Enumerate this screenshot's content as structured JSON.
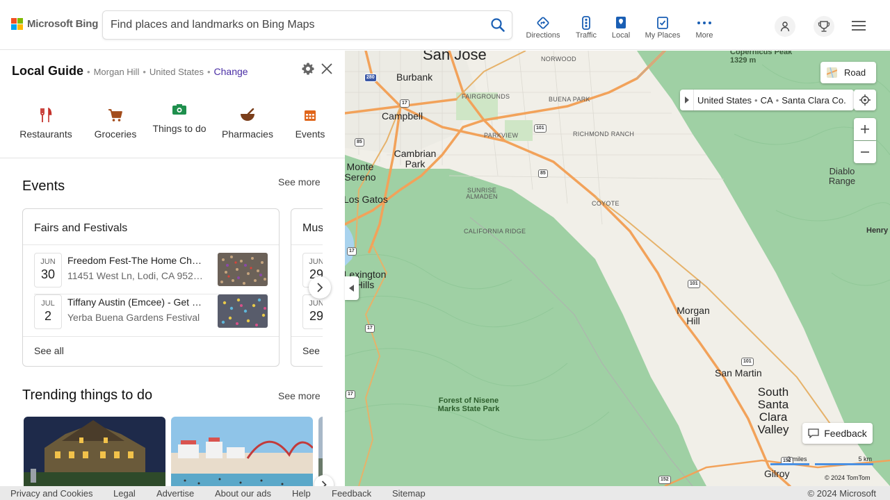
{
  "header": {
    "brand": "Microsoft Bing",
    "search_placeholder": "Find places and landmarks on Bing Maps",
    "nav": [
      {
        "label": "Directions",
        "icon": "directions-icon"
      },
      {
        "label": "Traffic",
        "icon": "traffic-icon"
      },
      {
        "label": "Local",
        "icon": "local-icon"
      },
      {
        "label": "My Places",
        "icon": "my-places-icon"
      },
      {
        "label": "More",
        "icon": "more-icon"
      }
    ],
    "accent": "#1a5fb4"
  },
  "panel": {
    "title": "Local Guide",
    "city": "Morgan Hill",
    "country": "United States",
    "change_label": "Change",
    "categories": [
      {
        "label": "Restaurants",
        "color": "#c5322b"
      },
      {
        "label": "Groceries",
        "color": "#a34c1b"
      },
      {
        "label": "Things to do",
        "color": "#1e8f4d"
      },
      {
        "label": "Pharmacies",
        "color": "#7a3e1b"
      },
      {
        "label": "Events",
        "color": "#e0661b"
      }
    ],
    "events": {
      "title": "Events",
      "see_more": "See more",
      "cards": [
        {
          "title": "Fairs and Festivals",
          "items": [
            {
              "month": "JUN",
              "day": "30",
              "title": "Freedom Fest-The Home Ch…",
              "address": "11451 West Ln, Lodi, CA 952…"
            },
            {
              "month": "JUL",
              "day": "2",
              "title": "Tiffany Austin (Emcee) - Get F…",
              "address": "Yerba Buena Gardens Festival"
            }
          ],
          "see_all": "See all"
        },
        {
          "title": "Mus",
          "items": [
            {
              "month": "JUN",
              "day": "29"
            },
            {
              "month": "JUN",
              "day": "29"
            }
          ],
          "see_all": "See"
        }
      ]
    },
    "trending": {
      "title": "Trending things to do",
      "see_more": "See more"
    }
  },
  "map": {
    "layer_label": "Road",
    "breadcrumb": [
      "United States",
      "CA",
      "Santa Clara Co."
    ],
    "feedback_label": "Feedback",
    "scale_imperial": "2 miles",
    "scale_metric": "5 km",
    "attribution": "© 2024 TomTom",
    "labels": {
      "san_jose": "San Jose",
      "burbank": "Burbank",
      "campbell": "Campbell",
      "cambrian": "Cambrian Park",
      "monte": "Monte Sereno",
      "los_gatos": "Los Gatos",
      "lexington": "Lexington Hills",
      "morgan_hill": "Morgan Hill",
      "san_martin": "San Martin",
      "south_santa_clara": "South Santa Clara Valley",
      "gilroy": "Gilroy",
      "diablo": "Diablo Range",
      "henry": "Henry",
      "copernicus": "Copernicus Peak",
      "copernicus_elev": "1329 m",
      "norwood": "NORWOOD",
      "fairgrounds": "FAIRGROUNDS",
      "buena_park": "BUENA PARK",
      "parkview": "PARKVIEW",
      "richmond_ranch": "RICHMOND RANCH",
      "sunrise": "SUNRISE ALMADEN",
      "coyote": "COYOTE",
      "california_ridge": "CALIFORNIA RIDGE",
      "forest": "Forest of Nisene Marks State Park"
    },
    "shields": [
      "280",
      "17",
      "101",
      "85",
      "85",
      "17",
      "101",
      "17",
      "101",
      "17",
      "152",
      "152"
    ]
  },
  "footer": {
    "links": [
      "Privacy and Cookies",
      "Legal",
      "Advertise",
      "About our ads",
      "Help",
      "Feedback",
      "Sitemap"
    ],
    "copyright": "© 2024 Microsoft"
  }
}
